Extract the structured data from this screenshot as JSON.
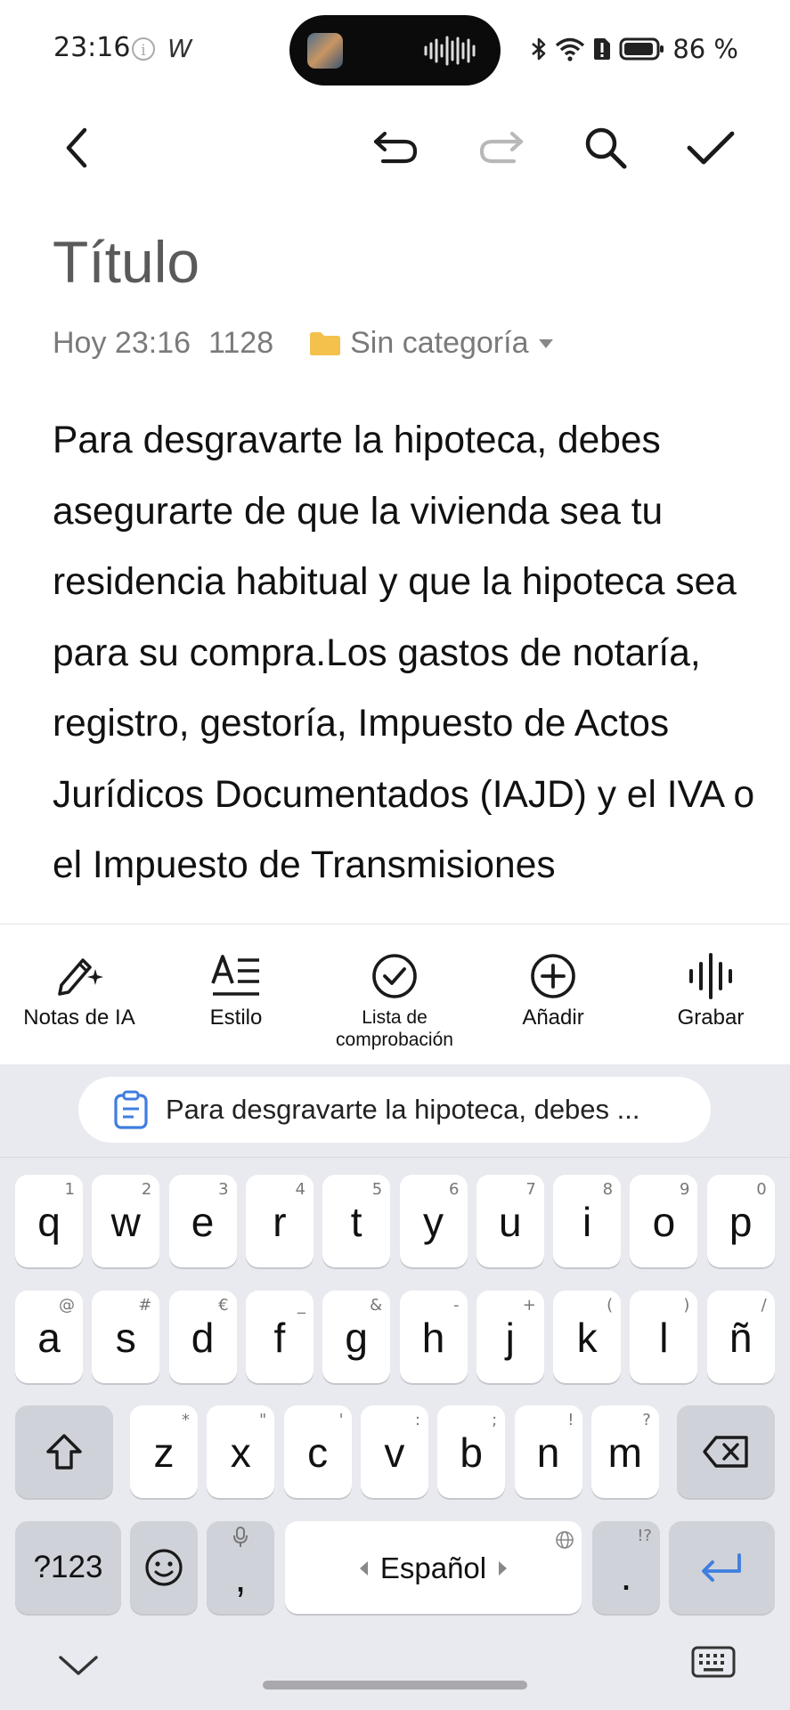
{
  "status_bar": {
    "time": "23:16",
    "info_icon": "i",
    "app_letter": "W",
    "battery": "86 %"
  },
  "toolbar": {
    "back_icon": "chevron-left-icon",
    "undo_icon": "undo-icon",
    "redo_icon": "redo-icon",
    "search_icon": "search-icon",
    "confirm_icon": "check-icon"
  },
  "note": {
    "title": "Título",
    "date": "Hoy 23:16",
    "char_count": "1128",
    "category": "Sin categoría",
    "body": "Para desgravarte la hipoteca, debes asegurarte de que la vivienda sea tu residencia habitual y que la hipoteca sea para su compra.Los gastos de notaría, registro, gestoría, Impuesto de Actos Jurídicos Documentados (IAJD) y el IVA o el Impuesto de Transmisiones"
  },
  "actions": [
    {
      "label": "Notas de IA",
      "icon": "ai-pen-icon"
    },
    {
      "label": "Estilo",
      "icon": "text-style-icon"
    },
    {
      "label": "Lista de comprobación",
      "icon": "checklist-icon"
    },
    {
      "label": "Añadir",
      "icon": "add-circle-icon"
    },
    {
      "label": "Grabar",
      "icon": "record-wave-icon"
    }
  ],
  "keyboard": {
    "clipboard_suggestion": "Para desgravarte la hipoteca, debes ...",
    "row1": [
      {
        "k": "q",
        "h": "1"
      },
      {
        "k": "w",
        "h": "2"
      },
      {
        "k": "e",
        "h": "3"
      },
      {
        "k": "r",
        "h": "4"
      },
      {
        "k": "t",
        "h": "5"
      },
      {
        "k": "y",
        "h": "6"
      },
      {
        "k": "u",
        "h": "7"
      },
      {
        "k": "i",
        "h": "8"
      },
      {
        "k": "o",
        "h": "9"
      },
      {
        "k": "p",
        "h": "0"
      }
    ],
    "row2": [
      {
        "k": "a",
        "h": "@"
      },
      {
        "k": "s",
        "h": "#"
      },
      {
        "k": "d",
        "h": "€"
      },
      {
        "k": "f",
        "h": "_"
      },
      {
        "k": "g",
        "h": "&"
      },
      {
        "k": "h",
        "h": "-"
      },
      {
        "k": "j",
        "h": "+"
      },
      {
        "k": "k",
        "h": "("
      },
      {
        "k": "l",
        "h": ")"
      },
      {
        "k": "ñ",
        "h": "/"
      }
    ],
    "row3": [
      {
        "k": "z",
        "h": "*"
      },
      {
        "k": "x",
        "h": "\""
      },
      {
        "k": "c",
        "h": "'"
      },
      {
        "k": "v",
        "h": ":"
      },
      {
        "k": "b",
        "h": ";"
      },
      {
        "k": "n",
        "h": "!"
      },
      {
        "k": "m",
        "h": "?"
      }
    ],
    "symbols_key": "?123",
    "comma_key": ",",
    "space_label": "Español",
    "period_key": ".",
    "period_hint": "!?",
    "enter_icon": "enter-arrow-icon"
  },
  "colors": {
    "accent_blue": "#3f7de0",
    "folder_yellow": "#f3c14c",
    "keyboard_bg": "#e9eaef"
  }
}
